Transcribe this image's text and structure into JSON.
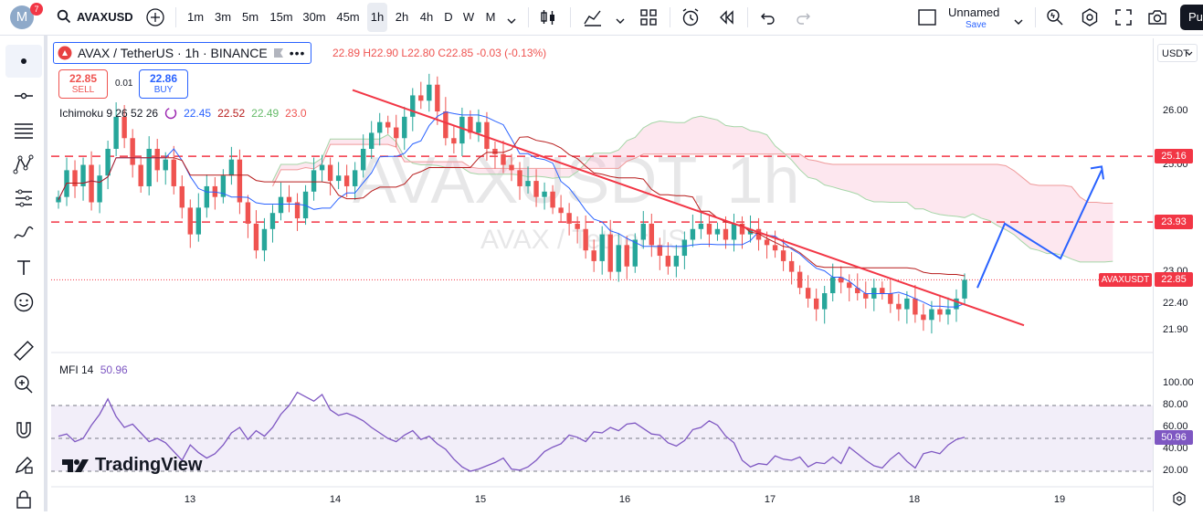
{
  "header": {
    "badge": "7",
    "symbol": "AVAXUSD",
    "timeframes": [
      "1m",
      "3m",
      "5m",
      "15m",
      "30m",
      "45m",
      "1h",
      "2h",
      "4h",
      "D",
      "W",
      "M"
    ],
    "active_timeframe": "1h",
    "layout_name": "Unnamed",
    "save_label": "Save",
    "publish_label": "Pu"
  },
  "legend": {
    "title": "AVAX / TetherUS · 1h · BINANCE",
    "ohlc": "22.89 H22.90 L22.80 C22.85 -0.03 (-0.13%)",
    "sell_price": "22.85",
    "sell_label": "SELL",
    "spread": "0.01",
    "buy_price": "22.86",
    "buy_label": "BUY",
    "indicator_name": "Ichimoku 9 26 52 26",
    "indicator_values": [
      "22.45",
      "22.52",
      "22.49",
      "23.0"
    ],
    "mfi_label": "MFI 14",
    "mfi_value": "50.96"
  },
  "watermark": {
    "big": "AVAXUSDT, 1h",
    "small": "AVAX / TetherUS"
  },
  "branding": "TradingView",
  "currency_selector": "USDT",
  "colors": {
    "up": "#26a69a",
    "down": "#ef5350",
    "tenkan": "#2962ff",
    "kijun": "#b71c1c",
    "level": "#f23645",
    "arrow": "#2962ff",
    "mfi": "#7e57c2"
  },
  "chart_data": [
    {
      "type": "candlestick",
      "symbol": "AVAXUSDT",
      "interval": "1h",
      "exchange": "BINANCE",
      "ylim": [
        21.6,
        26.5
      ],
      "y_ticks": [
        "26.00",
        "25.00",
        "23.00",
        "22.40",
        "21.90"
      ],
      "x_ticks": [
        "13",
        "14",
        "15",
        "16",
        "17",
        "18",
        "19"
      ],
      "levels": [
        {
          "label": "25.16",
          "value": 25.16
        },
        {
          "label": "23.93",
          "value": 23.93
        }
      ],
      "last_price": {
        "label": "AVAXUSDT",
        "value": "22.85"
      },
      "trendline": {
        "from": {
          "x": "14",
          "y": 26.4
        },
        "to": {
          "x": "18.75",
          "y": 22.0
        }
      },
      "projection": [
        22.7,
        23.9,
        23.25,
        24.9
      ],
      "close_series": [
        24.4,
        24.9,
        24.6,
        25.0,
        24.3,
        24.8,
        25.3,
        25.9,
        25.5,
        25.0,
        24.6,
        25.3,
        24.9,
        25.1,
        24.6,
        24.2,
        23.7,
        24.2,
        24.6,
        24.4,
        24.8,
        25.1,
        24.3,
        23.9,
        23.4,
        23.8,
        24.1,
        24.4,
        24.3,
        24.0,
        24.5,
        24.9,
        25.0,
        24.7,
        24.8,
        24.6,
        24.9,
        25.3,
        25.6,
        25.8,
        25.7,
        25.5,
        25.9,
        26.3,
        26.2,
        26.5,
        26.0,
        25.5,
        25.4,
        25.9,
        25.6,
        25.8,
        25.3,
        25.2,
        25.0,
        24.9,
        24.6,
        24.7,
        24.4,
        24.5,
        24.2,
        24.1,
        23.9,
        23.8,
        23.4,
        23.2,
        23.7,
        23.0,
        23.5,
        23.1,
        23.6,
        23.9,
        23.5,
        23.3,
        23.1,
        23.3,
        23.6,
        23.8,
        23.9,
        23.7,
        23.8,
        23.6,
        23.9,
        23.7,
        23.8,
        23.6,
        23.5,
        23.4,
        23.2,
        23.0,
        22.7,
        22.5,
        22.3,
        22.6,
        22.9,
        22.8,
        22.7,
        22.6,
        22.5,
        22.7,
        22.6,
        22.4,
        22.3,
        22.5,
        22.2,
        22.1,
        22.3,
        22.2,
        22.3,
        22.5,
        22.85
      ]
    },
    {
      "type": "line",
      "name": "MFI 14",
      "ylim": [
        10,
        100
      ],
      "y_ticks": [
        "100.00",
        "80.00",
        "60.00",
        "40.00",
        "20.00"
      ],
      "bands": [
        20,
        50,
        80
      ],
      "values": [
        52,
        54,
        47,
        50,
        62,
        72,
        86,
        70,
        60,
        63,
        55,
        47,
        50,
        46,
        38,
        30,
        44,
        37,
        32,
        36,
        44,
        55,
        60,
        49,
        57,
        52,
        60,
        72,
        80,
        92,
        88,
        84,
        90,
        76,
        71,
        73,
        70,
        66,
        60,
        55,
        50,
        47,
        53,
        57,
        49,
        52,
        45,
        40,
        31,
        24,
        20,
        22,
        25,
        28,
        32,
        22,
        21,
        24,
        30,
        38,
        42,
        45,
        53,
        51,
        47,
        56,
        55,
        60,
        57,
        63,
        64,
        59,
        54,
        53,
        46,
        43,
        48,
        58,
        60,
        66,
        62,
        52,
        46,
        30,
        24,
        27,
        26,
        34,
        31,
        30,
        33,
        24,
        28,
        27,
        33,
        27,
        42,
        36,
        30,
        25,
        23,
        31,
        37,
        29,
        23,
        36,
        38,
        36,
        44,
        49,
        51
      ]
    }
  ]
}
